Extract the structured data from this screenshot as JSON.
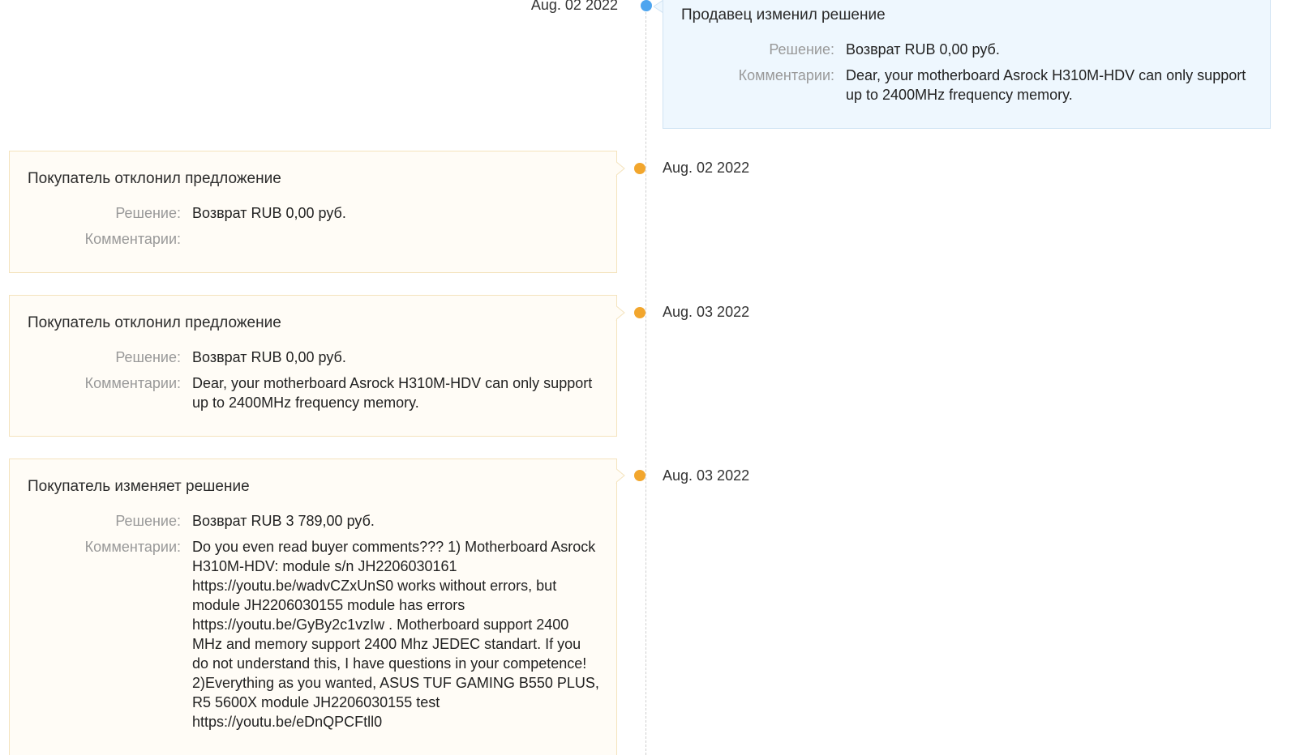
{
  "labels": {
    "decision": "Решение:",
    "comments": "Комментарии:"
  },
  "colors": {
    "seller_dot": "#4ea5ef",
    "buyer_dot": "#f2a62d",
    "seller_card_bg": "#eef7fe",
    "buyer_card_bg": "#fffcf6"
  },
  "events": [
    {
      "side": "seller",
      "date": "Aug. 02 2022",
      "title": "Продавец изменил решение",
      "decision": "Возврат RUB 0,00 руб.",
      "comment": "Dear, your motherboard Asrock H310M-HDV can only support up to 2400MHz frequency memory."
    },
    {
      "side": "buyer",
      "date": "Aug. 02 2022",
      "title": "Покупатель отклонил предложение",
      "decision": "Возврат RUB 0,00 руб.",
      "comment": ""
    },
    {
      "side": "buyer",
      "date": "Aug. 03 2022",
      "title": "Покупатель отклонил предложение",
      "decision": "Возврат RUB 0,00 руб.",
      "comment": "Dear, your motherboard Asrock H310M-HDV can only support up to 2400MHz frequency memory."
    },
    {
      "side": "buyer",
      "date": "Aug. 03 2022",
      "title": "Покупатель изменяет решение",
      "decision": "Возврат RUB 3 789,00 руб.",
      "comment": "Do you even read buyer comments??? 1) Motherboard Asrock H310M-HDV: module s/n JH2206030161 https://youtu.be/wadvCZxUnS0 works without errors, but module JH2206030155 module has errors https://youtu.be/GyBy2c1vzIw . Motherboard support 2400 MHz and memory support 2400 Mhz JEDEC standart. If you do not understand this, I have questions in your competence! 2)Everything as you wanted, ASUS TUF GAMING B550 PLUS, R5 5600X module JH2206030155 test https://youtu.be/eDnQPCFtll0"
    }
  ]
}
